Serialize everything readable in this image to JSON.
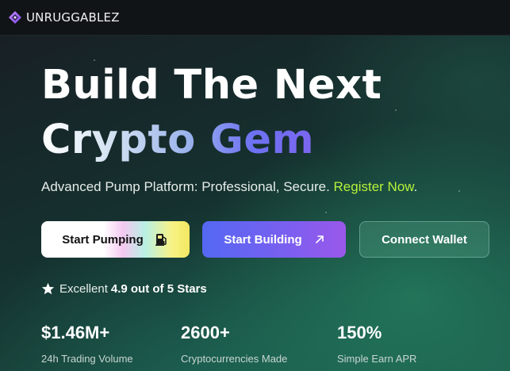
{
  "brand": {
    "name": "UNRUGGABLEZ",
    "logo_icon": "diamond-logo-icon",
    "accent": "#8a58ec"
  },
  "hero": {
    "headline_line1": "Build The Next",
    "headline_line2": "Crypto Gem",
    "subtitle_text": "Advanced Pump Platform: Professional, Secure. ",
    "subtitle_link": "Register Now",
    "subtitle_end": ".",
    "link_color": "#b6f23a"
  },
  "buttons": {
    "start_pumping": {
      "label": "Start Pumping",
      "icon": "fuel-pump-icon"
    },
    "start_building": {
      "label": "Start Building",
      "icon": "arrow-up-right-icon"
    },
    "connect_wallet": {
      "label": "Connect Wallet"
    }
  },
  "rating": {
    "prefix": "Excellent",
    "score": "4.9 out of 5 Stars",
    "icon": "star-icon"
  },
  "stats": [
    {
      "value": "$1.46M+",
      "label": "24h Trading Volume"
    },
    {
      "value": "2600+",
      "label": "Cryptocurrencies Made"
    },
    {
      "value": "150%",
      "label": "Simple Earn APR"
    }
  ]
}
